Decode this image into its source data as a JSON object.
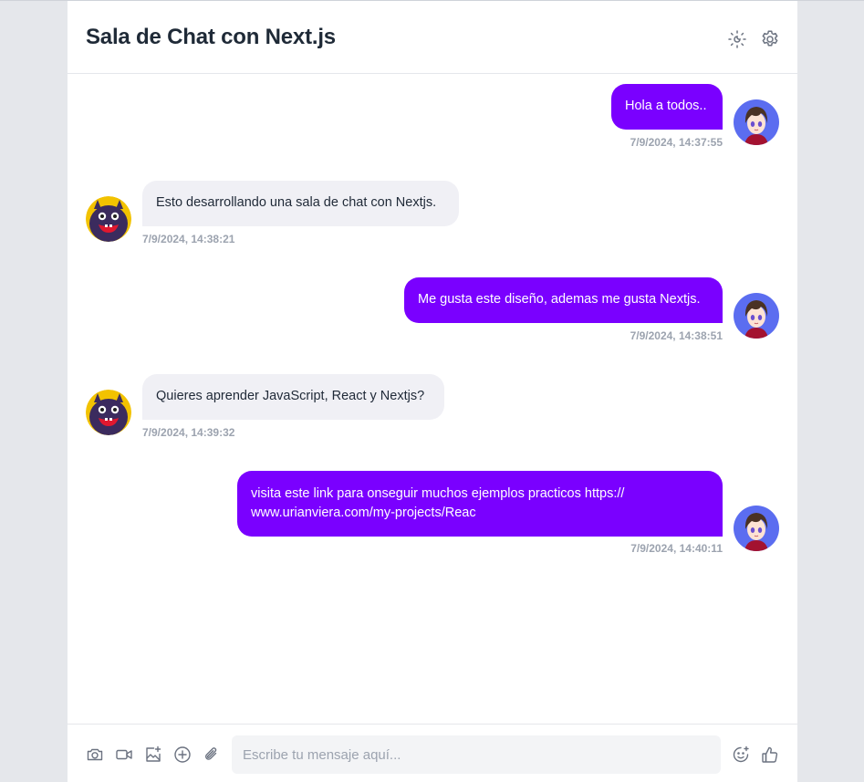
{
  "header": {
    "title": "Sala de Chat con Next.js",
    "theme_icon": "sun-moon-icon",
    "settings_icon": "gear-icon"
  },
  "colors": {
    "accent": "#7a00ff",
    "incoming_bubble": "#f0f0f5",
    "timestamp": "#9ca3af"
  },
  "messages": [
    {
      "sender": "me",
      "text": "Hola a todos..",
      "time": "7/9/2024, 14:37:55",
      "avatar": "anime-avatar"
    },
    {
      "sender": "them",
      "text": "Esto desarrollando una sala de chat con Nextjs.",
      "time": "7/9/2024, 14:38:21",
      "avatar": "monster-avatar"
    },
    {
      "sender": "me",
      "text": "Me gusta este diseño, ademas me gusta Nextjs.",
      "time": "7/9/2024, 14:38:51",
      "avatar": "anime-avatar"
    },
    {
      "sender": "them",
      "text": "Quieres aprender JavaScript, React y Nextjs?",
      "time": "7/9/2024, 14:39:32",
      "avatar": "monster-avatar"
    },
    {
      "sender": "me",
      "text": "visita este link para onseguir muchos ejemplos practicos https:// www.urianviera.com/my-projects/Reac",
      "time": "7/9/2024, 14:40:11",
      "avatar": "anime-avatar"
    }
  ],
  "composer": {
    "placeholder": "Escribe tu mensaje aquí...",
    "value": "",
    "icons": [
      "camera-icon",
      "video-icon",
      "image-add-icon",
      "plus-circle-icon",
      "paperclip-icon",
      "emoji-icon",
      "thumbs-up-icon"
    ]
  }
}
